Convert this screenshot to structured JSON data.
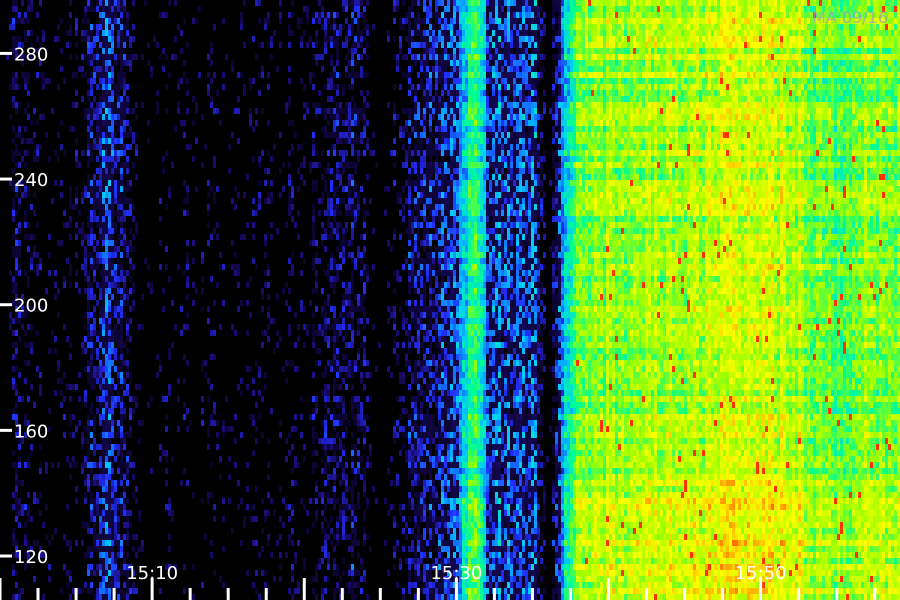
{
  "chart_data": {
    "type": "heatmap",
    "title": "",
    "corner_label": "MA 09/16",
    "xlabel": "",
    "ylabel": "",
    "x_tick_labels": [
      "15:10",
      "15:30",
      "15:50"
    ],
    "x_range_minutes": [
      15.0,
      15.986
    ],
    "y_ticks": [
      120,
      160,
      200,
      240,
      280
    ],
    "ylim": [
      106,
      297
    ],
    "colormap": [
      "#000000",
      "#1a0a6e",
      "#2030ff",
      "#00c8ff",
      "#00ff90",
      "#a0ff00",
      "#ffff00",
      "#ff8000",
      "#ff0000"
    ],
    "intensity_profile": [
      {
        "time": "15:00",
        "level": 0.0
      },
      {
        "time": "15:01",
        "level": 0.18
      },
      {
        "time": "15:02",
        "level": 0.1
      },
      {
        "time": "15:03",
        "level": 0.06
      },
      {
        "time": "15:05",
        "level": 0.1
      },
      {
        "time": "15:07",
        "level": 0.28
      },
      {
        "time": "15:08",
        "level": 0.22
      },
      {
        "time": "15:09",
        "level": 0.06
      },
      {
        "time": "15:13",
        "level": 0.08
      },
      {
        "time": "15:20",
        "level": 0.1
      },
      {
        "time": "15:23",
        "level": 0.2
      },
      {
        "time": "15:25",
        "level": 0.04
      },
      {
        "time": "15:27",
        "level": 0.18
      },
      {
        "time": "15:30",
        "level": 0.32
      },
      {
        "time": "15:31",
        "level": 0.55
      },
      {
        "time": "15:32",
        "level": 0.3
      },
      {
        "time": "15:35",
        "level": 0.32
      },
      {
        "time": "15:36",
        "level": 0.04
      },
      {
        "time": "15:37",
        "level": 0.4
      },
      {
        "time": "15:38",
        "level": 0.58
      },
      {
        "time": "15:40",
        "level": 0.62
      },
      {
        "time": "15:45",
        "level": 0.66
      },
      {
        "time": "15:50",
        "level": 0.7
      },
      {
        "time": "15:53",
        "level": 0.62
      },
      {
        "time": "15:55",
        "level": 0.55
      },
      {
        "time": "15:57",
        "level": 0.62
      },
      {
        "time": "15:59",
        "level": 0.58
      }
    ],
    "grid": false,
    "legend": "none"
  }
}
